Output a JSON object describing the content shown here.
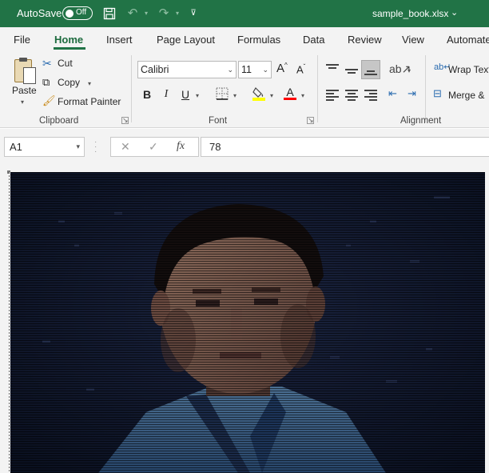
{
  "titlebar": {
    "autosave_label": "AutoSave",
    "autosave_state": "Off",
    "filename": "sample_book.xlsx",
    "icons": [
      "save-icon",
      "undo-icon",
      "redo-icon",
      "customize-qat-icon",
      "chevron-down-icon"
    ]
  },
  "tabs": [
    "File",
    "Home",
    "Insert",
    "Page Layout",
    "Formulas",
    "Data",
    "Review",
    "View",
    "Automate"
  ],
  "active_tab": "Home",
  "ribbon": {
    "clipboard": {
      "paste_label": "Paste",
      "cut_label": "Cut",
      "copy_label": "Copy",
      "format_painter_label": "Format Painter",
      "group_label": "Clipboard"
    },
    "font": {
      "font_name": "Calibri",
      "font_size": "11",
      "bold": "B",
      "italic": "I",
      "underline": "U",
      "group_label": "Font",
      "grow_font": "A",
      "shrink_font": "A",
      "font_color_letter": "A"
    },
    "alignment": {
      "wrap_text_label": "Wrap Text",
      "merge_label": "Merge &",
      "group_label": "Alignment"
    }
  },
  "formula_bar": {
    "name_box": "A1",
    "value": "78",
    "fx_label": "fx",
    "cancel": "✕",
    "enter": "✓"
  },
  "colors": {
    "brand": "#217346",
    "tab_active": "#1d6b3e",
    "ribbon_bg": "#f3f3f3",
    "highlight_yellow": "#ffff00",
    "font_color_red": "#ff0000"
  },
  "sheet": {
    "content": "pixel-art image rendered via cell fill colors (portrait)"
  }
}
